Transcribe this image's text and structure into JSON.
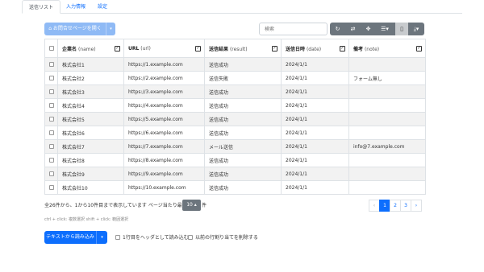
{
  "tabs": [
    "送信リスト",
    "入力情報",
    "設定"
  ],
  "open_button": {
    "label": "お問合せページを開く",
    "icon": "inbox-icon",
    "split_icon": "▾"
  },
  "search": {
    "placeholder": "検索"
  },
  "toolbar": {
    "buttons": [
      {
        "name": "refresh-icon",
        "glyph": "↻"
      },
      {
        "name": "toggle-view-icon",
        "glyph": "⇄"
      },
      {
        "name": "fullscreen-icon",
        "glyph": "✥"
      },
      {
        "name": "columns-icon",
        "glyph": "☰▾"
      },
      {
        "name": "clipboard-icon",
        "glyph": "▯"
      },
      {
        "name": "export-icon",
        "glyph": "⤓▾"
      }
    ]
  },
  "table": {
    "headers": [
      {
        "bold": "企業名",
        "sub": "(name)"
      },
      {
        "bold": "URL",
        "sub": "(url)"
      },
      {
        "bold": "送信結果",
        "sub": "(result)"
      },
      {
        "bold": "送信日時",
        "sub": "(date)"
      },
      {
        "bold": "備考",
        "sub": "(note)"
      }
    ],
    "header_check": "✓",
    "rows": [
      [
        "株式会社1",
        "https://1.example.com",
        "送信成功",
        "2024/1/1",
        ""
      ],
      [
        "株式会社2",
        "https://2.example.com",
        "送信失敗",
        "2024/1/1",
        "フォーム無し"
      ],
      [
        "株式会社3",
        "https://3.example.com",
        "送信成功",
        "2024/1/1",
        ""
      ],
      [
        "株式会社4",
        "https://4.example.com",
        "送信成功",
        "2024/1/1",
        ""
      ],
      [
        "株式会社5",
        "https://5.example.com",
        "送信成功",
        "2024/1/1",
        ""
      ],
      [
        "株式会社6",
        "https://6.example.com",
        "送信成功",
        "2024/1/1",
        ""
      ],
      [
        "株式会社7",
        "https://7.example.com",
        "メール送信",
        "2024/1/1",
        "info@7.example.com"
      ],
      [
        "株式会社8",
        "https://8.example.com",
        "送信成功",
        "2024/1/1",
        ""
      ],
      [
        "株式会社9",
        "https://9.example.com",
        "送信成功",
        "2024/1/1",
        ""
      ],
      [
        "株式会社10",
        "https://10.example.com",
        "送信成功",
        "2024/1/1",
        ""
      ]
    ]
  },
  "pagination": {
    "info_before": "全26件から、1から10件目まで表示しています ページ当たり最大",
    "per_page": "10 ▴",
    "info_after": "件",
    "prev": "‹",
    "pages": [
      "1",
      "2",
      "3"
    ],
    "next": "›"
  },
  "hint": "ctrl + click: 複数選択  shift + click: 範囲選択",
  "text_button": {
    "label": "テキストから読み込み",
    "split_icon": "▾"
  },
  "options": [
    "1行目をヘッダとして読み込む",
    "以前の行割り当てを削除する"
  ],
  "colors": {
    "primary": "#0d6efd",
    "primary_light": "#8fbaf5",
    "secondary": "#6c757d"
  }
}
